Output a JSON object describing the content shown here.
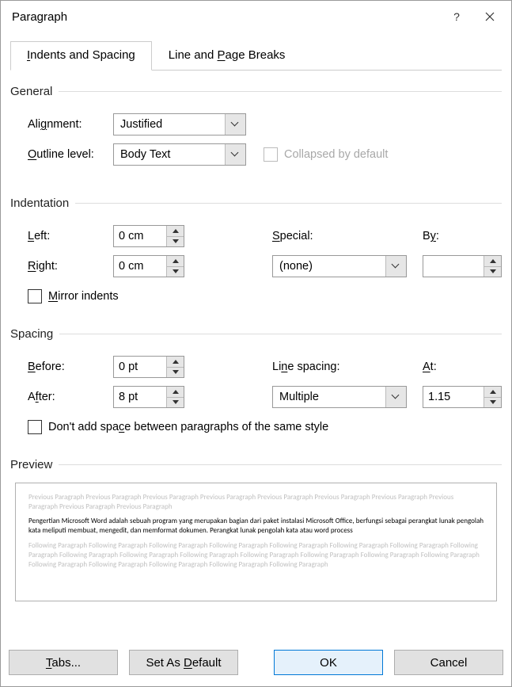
{
  "title": "Paragraph",
  "tabs": {
    "indents": "Indents and Spacing",
    "breaks": "Line and Page Breaks"
  },
  "general": {
    "heading": "General",
    "alignment_label": "Alignment:",
    "alignment_value": "Justified",
    "outline_label": "Outline level:",
    "outline_value": "Body Text",
    "collapsed_label": "Collapsed by default"
  },
  "indentation": {
    "heading": "Indentation",
    "left_label": "Left:",
    "left_value": "0 cm",
    "right_label": "Right:",
    "right_value": "0 cm",
    "special_label": "Special:",
    "special_value": "(none)",
    "by_label": "By:",
    "by_value": "",
    "mirror_label": "Mirror indents"
  },
  "spacing": {
    "heading": "Spacing",
    "before_label": "Before:",
    "before_value": "0 pt",
    "after_label": "After:",
    "after_value": "8 pt",
    "line_label": "Line spacing:",
    "line_value": "Multiple",
    "at_label": "At:",
    "at_value": "1.15",
    "nospace_label": "Don't add space between paragraphs of the same style"
  },
  "preview": {
    "heading": "Preview",
    "prev_text": "Previous Paragraph Previous Paragraph Previous Paragraph Previous Paragraph Previous Paragraph Previous Paragraph Previous Paragraph Previous Paragraph Previous Paragraph Previous Paragraph",
    "body_text": "Pengertian Microsoft Word adalah sebuah program yang merupakan bagian dari paket instalasi Microsoft Office, berfungsi sebagai perangkat lunak pengolah kata meliputi membuat, mengedit, dan memformat dokumen. Perangkat lunak pengolah kata atau word process",
    "follow_text": "Following Paragraph Following Paragraph Following Paragraph Following Paragraph Following Paragraph Following Paragraph Following Paragraph Following Paragraph Following Paragraph Following Paragraph Following Paragraph Following Paragraph Following Paragraph Following Paragraph Following Paragraph Following Paragraph Following Paragraph Following Paragraph Following Paragraph Following Paragraph"
  },
  "footer": {
    "tabs": "Tabs...",
    "setdef": "Set As Default",
    "ok": "OK",
    "cancel": "Cancel"
  }
}
